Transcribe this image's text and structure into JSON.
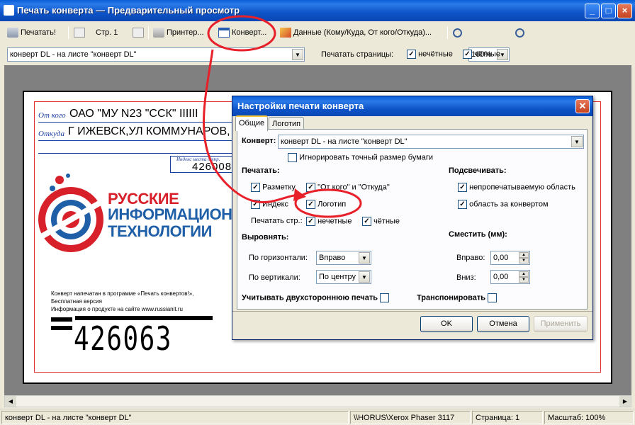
{
  "window": {
    "title": "Печать конверта — Предварительный просмотр"
  },
  "toolbar": {
    "print_label": "Печатать!",
    "page_label": "Стр. 1",
    "printer_label": "Принтер...",
    "envelope_label": "Конверт...",
    "data_label": "Данные (Кому/Куда, От кого/Откуда)...",
    "zoom_value": "100%",
    "envelope_select": "конверт DL - на листе \"конверт DL\"",
    "print_pages_label": "Печатать страницы:",
    "odd_label": "нечётные",
    "even_label": "чётные"
  },
  "envelope": {
    "from_label": "От кого",
    "from_value": "ОАО \"МУ N23 \"ССК\" IIIIII",
    "where_label": "Откуда",
    "where_value": "Г ИЖЕВСК,УЛ КОММУНАРОВ,",
    "index_label": "Индекс места отпр.",
    "index_value": "426008",
    "logo_line1": "РУССКИЕ",
    "logo_line2": "ИНФОРМАЦИОННЫЕ",
    "logo_line3": "ТЕХНОЛОГИИ",
    "credit_line1": "Конверт напечатан в программе «Печать конвертов!»,",
    "credit_line2": "Бесплатная версия",
    "credit_line3": "Информация о продукте на сайте www.russianit.ru",
    "barcode_digits": "426063"
  },
  "dialog": {
    "title": "Настройки печати конверта",
    "tab_general": "Общие",
    "tab_logo": "Логотип",
    "envelope_label": "Конверт:",
    "envelope_value": "конверт DL - на листе \"конверт DL\"",
    "ignore_size": "Игнорировать точный размер бумаги",
    "print_header": "Печатать:",
    "markup": "Разметку",
    "from_where": "\"От кого\" и \"Откуда\"",
    "index": "Индекс",
    "logo": "Логотип",
    "print_pages": "Печатать стр.:",
    "odd": "нечетные",
    "even": "чётные",
    "highlight_header": "Подсвечивать:",
    "nonprint_area": "непропечатываемую область",
    "outside_area": "область за конвертом",
    "align_header": "Выровнять:",
    "horiz_label": "По горизонтали:",
    "horiz_value": "Вправо",
    "vert_label": "По вертикали:",
    "vert_value": "По центру",
    "shift_header": "Сместить (мм):",
    "right_label": "Вправо:",
    "right_value": "0,00",
    "down_label": "Вниз:",
    "down_value": "0,00",
    "duplex": "Учитывать двухстороннюю печать",
    "transpose": "Транспонировать",
    "ok": "OK",
    "cancel": "Отмена",
    "apply": "Применить"
  },
  "status": {
    "envelope": "конверт DL - на листе \"конверт DL\"",
    "printer": "\\\\HORUS\\Xerox Phaser 3117",
    "page": "Страница: 1",
    "scale": "Масштаб: 100%"
  },
  "colors": {
    "accent": "#0a48b5",
    "annotation": "#e8202a",
    "logo_red": "#d8202a",
    "logo_blue": "#1f5fa8"
  }
}
